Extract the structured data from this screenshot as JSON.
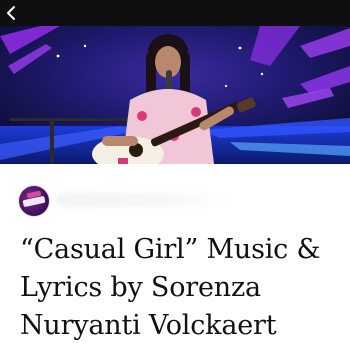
{
  "header": {
    "back_icon": "chevron-left-icon"
  },
  "hero": {
    "image": "performer-with-guitar-on-stage"
  },
  "meta": {
    "avatar_icon": "channel-logo-icon"
  },
  "article": {
    "title": "“Casual Girl” Music & Lyrics by Sorenza Nuryanti Volckaert"
  },
  "colors": {
    "topbar": "#0f0f12",
    "stage_blue": "#2b3fbf",
    "stage_purple": "#7a2ad0",
    "text": "#111111"
  }
}
